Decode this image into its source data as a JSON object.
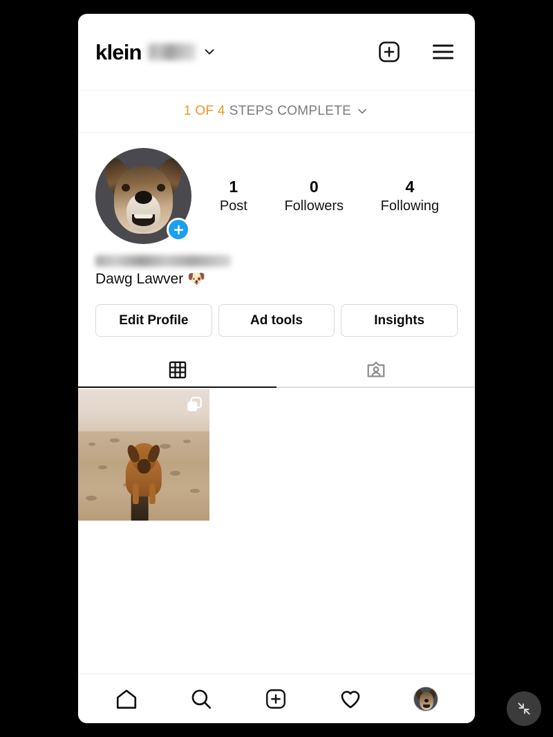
{
  "header": {
    "username_prefix": "klein",
    "username_redacted": true,
    "dropdown_icon": "chevron-down-icon",
    "create_icon": "plus-square-icon",
    "menu_icon": "hamburger-menu-icon"
  },
  "steps_banner": {
    "count_text": "1 OF 4",
    "label_text": "STEPS COMPLETE",
    "chevron_icon": "chevron-down-icon",
    "accent_color": "#f0951f",
    "label_color": "#7c7c7c"
  },
  "profile": {
    "avatar_alt": "dog-profile-photo",
    "story_badge_icon": "plus-icon",
    "story_badge_color": "#1c9fef",
    "display_name_redacted": true,
    "bio": "Dawg Lawver 🐶",
    "stats": [
      {
        "value": "1",
        "label": "Post"
      },
      {
        "value": "0",
        "label": "Followers"
      },
      {
        "value": "4",
        "label": "Following"
      }
    ],
    "buttons": [
      {
        "label": "Edit Profile"
      },
      {
        "label": "Ad tools"
      },
      {
        "label": "Insights"
      }
    ]
  },
  "tabs": [
    {
      "name": "grid-tab",
      "icon": "grid-icon",
      "active": true
    },
    {
      "name": "tagged-tab",
      "icon": "tagged-person-icon",
      "active": false
    }
  ],
  "posts": [
    {
      "alt": "dog-digging-in-sand-at-beach",
      "is_carousel": true,
      "carousel_icon": "carousel-stack-icon",
      "selected": true,
      "selection_color": "#e8231a"
    }
  ],
  "bottom_nav": [
    {
      "name": "home",
      "icon": "home-icon"
    },
    {
      "name": "search",
      "icon": "search-icon"
    },
    {
      "name": "create",
      "icon": "plus-square-icon"
    },
    {
      "name": "activity",
      "icon": "heart-icon"
    },
    {
      "name": "profile",
      "icon": "avatar-icon"
    }
  ],
  "floating_button": {
    "name": "collapse-button",
    "icon": "collapse-arrows-icon",
    "background": "#3b3b3b"
  }
}
